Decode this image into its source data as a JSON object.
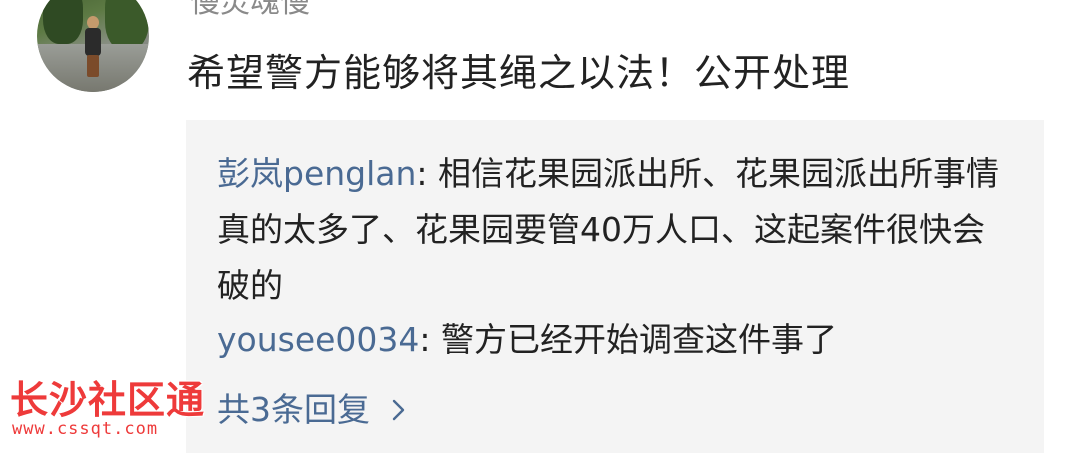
{
  "comment": {
    "username": "慢灵魂慢",
    "text": "希望警方能够将其绳之以法！公开处理"
  },
  "replies": [
    {
      "user": "彭岚penglan",
      "separator": ": ",
      "text": "相信花果园派出所、花果园派出所事情真的太多了、花果园要管40万人口、这起案件很快会破的"
    },
    {
      "user": "yousee0034",
      "separator": ": ",
      "text": "警方已经开始调查这件事了"
    }
  ],
  "more_replies": {
    "label": "共3条回复",
    "icon": "chevron-right-icon"
  },
  "watermark": {
    "title": "长沙社区通",
    "url": "www.cssqt.com"
  },
  "colors": {
    "link": "#4a6a93",
    "text": "#222222",
    "username": "#8a8a8a",
    "reply_background": "#f4f4f4",
    "watermark": "#ee3a3a"
  }
}
